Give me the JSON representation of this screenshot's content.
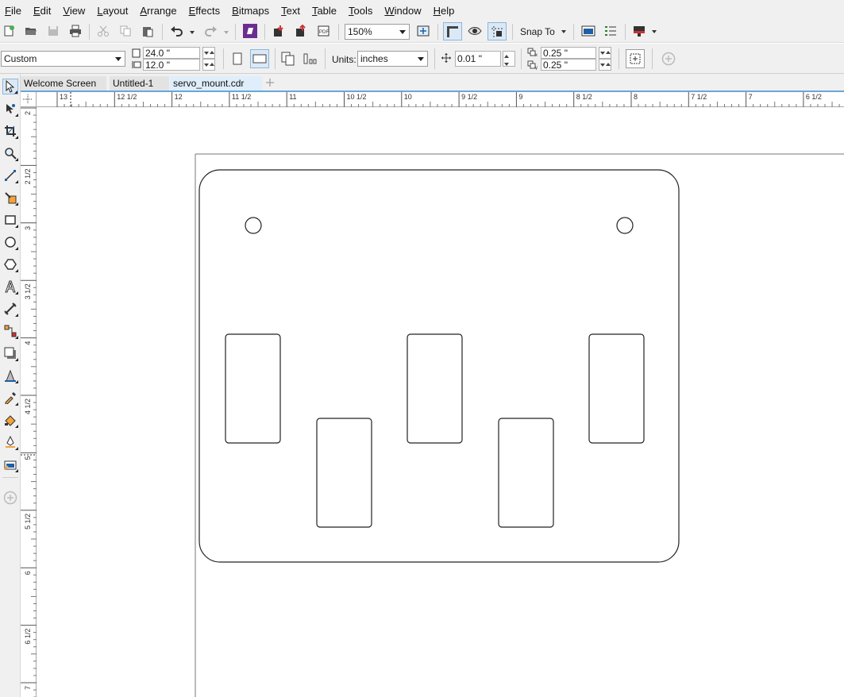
{
  "menu": [
    {
      "label": "File"
    },
    {
      "label": "Edit"
    },
    {
      "label": "View"
    },
    {
      "label": "Layout"
    },
    {
      "label": "Arrange"
    },
    {
      "label": "Effects"
    },
    {
      "label": "Bitmaps"
    },
    {
      "label": "Text"
    },
    {
      "label": "Table"
    },
    {
      "label": "Tools"
    },
    {
      "label": "Window"
    },
    {
      "label": "Help"
    }
  ],
  "toolbar": {
    "zoom_value": "150%",
    "snap_label": "Snap To",
    "icons": [
      "new-document-icon",
      "open-icon",
      "save-icon",
      "print-icon",
      "cut-icon",
      "copy-icon",
      "paste-icon",
      "undo-icon",
      "redo-icon",
      "corel-connect-icon",
      "import-icon",
      "export-icon",
      "publish-pdf-icon",
      "zoom-page-icon",
      "rulers-icon",
      "wireframe-icon",
      "guidelines-icon",
      "options-icon",
      "settings-icon",
      "launch-icon"
    ]
  },
  "property_bar": {
    "page_preset": "Custom",
    "width_value": "24.0 \"",
    "height_value": "12.0 \"",
    "units_label": "Units:",
    "units_value": "inches",
    "nudge_value": "0.01 \"",
    "dup_x_value": "0.25 \"",
    "dup_y_value": "0.25 \""
  },
  "tabs": [
    {
      "label": "Welcome Screen",
      "active": false
    },
    {
      "label": "Untitled-1",
      "active": false
    },
    {
      "label": "servo_mount.cdr",
      "active": true
    }
  ],
  "rulers": {
    "horizontal_labels": [
      "13",
      "12 1/2",
      "12",
      "11 1/2",
      "11",
      "10 1/2",
      "10",
      "9 1/2",
      "9",
      "8 1/2",
      "8",
      "7 1/2",
      "7",
      "6 1/2"
    ],
    "vertical_labels": [
      "2",
      "2 1/2",
      "3",
      "3 1/2",
      "4",
      "4 1/2",
      "5",
      "5 1/2",
      "6",
      "6 1/2",
      "7"
    ]
  },
  "colors": {
    "chrome": "#f0f0f0",
    "active_tab": "#dfeefa",
    "accent": "#6aa6d8",
    "corel_purple": "#6b2d8f",
    "shape_stroke": "#222222"
  },
  "drawing": {
    "name": "servo mount plate",
    "mount_holes": 2,
    "servo_cutouts": 5
  }
}
